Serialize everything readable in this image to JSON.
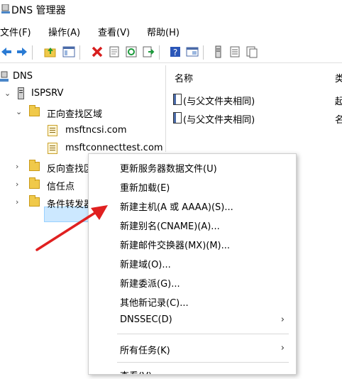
{
  "window": {
    "title": "DNS 管理器"
  },
  "menubar": [
    "文件(F)",
    "操作(A)",
    "查看(V)",
    "帮助(H)"
  ],
  "toolbar": {
    "icons": [
      "back-icon",
      "forward-icon",
      "up-folder-icon",
      "show-hide-tree-icon",
      "delete-icon",
      "properties-icon",
      "refresh-icon",
      "export-list-icon",
      "help-icon",
      "view-icon",
      "server-icon",
      "list-icon",
      "detail-icon"
    ]
  },
  "tree": {
    "root": "DNS",
    "server": "ISPSRV",
    "forward_zones": "正向查找区域",
    "zone1": "msftncsi.com",
    "zone2": "msftconnecttest.com",
    "reverse_zones": "反向查找区域",
    "trust_points": "信任点",
    "conditional_forwarders": "条件转发器"
  },
  "list": {
    "col_name": "名称",
    "col_type": "类",
    "rows": [
      {
        "name": "(与父文件夹相同)",
        "type": "起"
      },
      {
        "name": "(与父文件夹相同)",
        "type": "名"
      }
    ]
  },
  "context_menu": {
    "items": [
      "更新服务器数据文件(U)",
      "重新加载(E)",
      "新建主机(A 或 AAAA)(S)...",
      "新建别名(CNAME)(A)...",
      "新建邮件交换器(MX)(M)...",
      "新建域(O)...",
      "新建委派(G)...",
      "其他新记录(C)...",
      "DNSSEC(D)"
    ],
    "all_tasks": "所有任务(K)",
    "view": "查看(V)",
    "submenu_arrow": "›"
  },
  "annotation": {
    "arrow_color": "#e02020"
  }
}
